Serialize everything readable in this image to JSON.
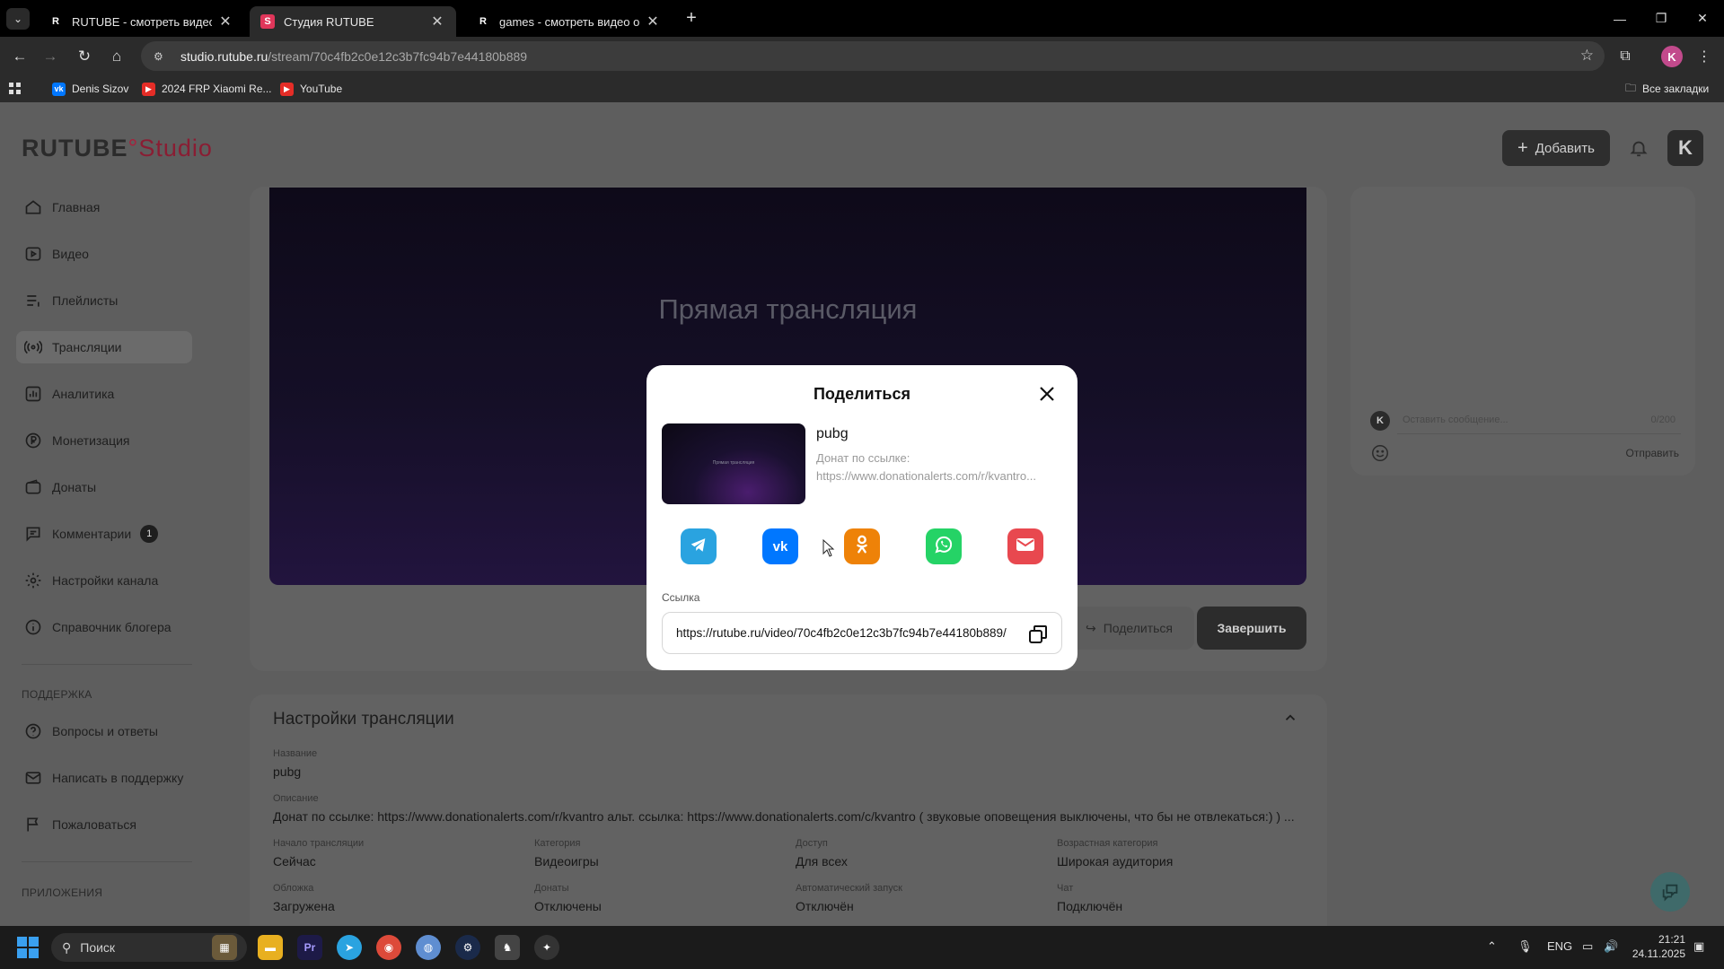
{
  "browser": {
    "tabs": [
      {
        "label": "RUTUBE - смотреть видео онлайн",
        "active": false
      },
      {
        "label": "Студия RUTUBE",
        "active": true
      },
      {
        "label": "games - смотреть видео онлайн",
        "active": false
      }
    ],
    "url_host": "studio.rutube.ru",
    "url_path": "/stream/70c4fb2c0e12c3b7fc94b7e44180b889",
    "profile_initial": "K",
    "bookmarks": [
      {
        "label": "Denis Sizov",
        "icon": "vk-icon"
      },
      {
        "label": "2024 FRP Xiaomi Re...",
        "icon": "youtube-icon"
      },
      {
        "label": "YouTube",
        "icon": "youtube-icon"
      }
    ],
    "all_bookmarks_label": "Все закладки"
  },
  "app": {
    "logo_main": "RUTUBE",
    "logo_studio": "Studio",
    "add_label": "Добавить",
    "avatar_initial": "K",
    "brand_color": "#a8203c"
  },
  "sidebar": {
    "items": [
      {
        "label": "Главная",
        "icon": "home-icon"
      },
      {
        "label": "Видео",
        "icon": "video-icon"
      },
      {
        "label": "Плейлисты",
        "icon": "playlist-icon"
      },
      {
        "label": "Трансляции",
        "icon": "broadcast-icon",
        "active": true
      },
      {
        "label": "Аналитика",
        "icon": "analytics-icon"
      },
      {
        "label": "Монетизация",
        "icon": "ruble-icon"
      },
      {
        "label": "Донаты",
        "icon": "wallet-icon"
      },
      {
        "label": "Комментарии",
        "icon": "comment-icon",
        "badge": "1"
      },
      {
        "label": "Настройки канала",
        "icon": "gear-icon"
      },
      {
        "label": "Справочник блогера",
        "icon": "info-icon"
      }
    ],
    "support_title": "ПОДДЕРЖКА",
    "support_items": [
      {
        "label": "Вопросы и ответы",
        "icon": "question-icon"
      },
      {
        "label": "Написать в поддержку",
        "icon": "mail-icon"
      },
      {
        "label": "Пожаловаться",
        "icon": "flag-icon"
      }
    ],
    "apps_title": "ПРИЛОЖЕНИЯ"
  },
  "stream": {
    "preview_title": "Прямая трансляция",
    "share_label": "Поделиться",
    "finish_label": "Завершить"
  },
  "chat": {
    "avatar_initial": "K",
    "placeholder": "Оставить сообщение...",
    "counter": "0/200",
    "send_label": "Отправить"
  },
  "settings": {
    "title": "Настройки трансляции",
    "name_label": "Название",
    "name_value": "pubg",
    "desc_label": "Описание",
    "desc_value": "Донат по ссылке: https://www.donationalerts.com/r/kvantro альт. ссылка: https://www.donationalerts.com/c/kvantro ( звуковые оповещения выключены, что бы не отвлекаться:) ) ...",
    "fields": [
      {
        "label": "Начало трансляции",
        "value": "Сейчас"
      },
      {
        "label": "Категория",
        "value": "Видеоигры"
      },
      {
        "label": "Доступ",
        "value": "Для всех"
      },
      {
        "label": "Возрастная категория",
        "value": "Широкая аудитория"
      },
      {
        "label": "Обложка",
        "value": "Загружена"
      },
      {
        "label": "Донаты",
        "value": "Отключены"
      },
      {
        "label": "Автоматический запуск",
        "value": "Отключён"
      },
      {
        "label": "Чат",
        "value": "Подключён"
      }
    ]
  },
  "modal": {
    "title": "Поделиться",
    "video_title": "pubg",
    "thumb_text": "Прямая трансляция",
    "donate_label": "Донат по ссылке:",
    "donate_link": "https://www.donationalerts.com/r/kvantro...",
    "social": [
      {
        "name": "telegram",
        "icon": "telegram-icon",
        "color": "#2aa3e0"
      },
      {
        "name": "vk",
        "icon": "vk-icon",
        "color": "#0077ff"
      },
      {
        "name": "odnoklassniki",
        "icon": "odnoklassniki-icon",
        "color": "#ee8208"
      },
      {
        "name": "whatsapp",
        "icon": "whatsapp-icon",
        "color": "#25d366"
      },
      {
        "name": "email",
        "icon": "email-icon",
        "color": "#e8484f"
      }
    ],
    "link_label": "Ссылка",
    "link_value": "https://rutube.ru/video/70c4fb2c0e12c3b7fc94b7e44180b889/"
  },
  "taskbar": {
    "search_label": "Поиск",
    "lang": "ENG",
    "time": "21:21",
    "date": "24.11.2025"
  }
}
